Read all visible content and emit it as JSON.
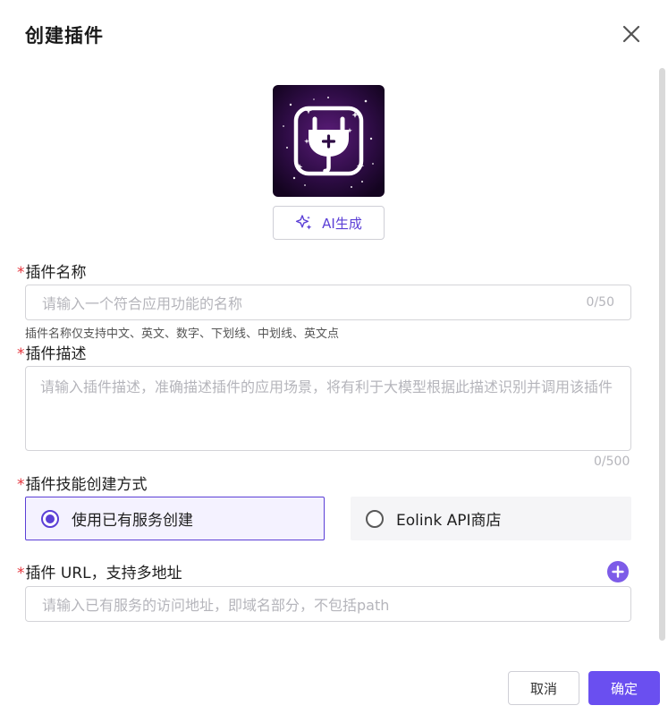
{
  "dialog": {
    "title": "创建插件",
    "ai_button_label": "AI生成",
    "name_field": {
      "required_mark": "*",
      "label": "插件名称",
      "placeholder": "请输入一个符合应用功能的名称",
      "counter": "0/50",
      "hint": "插件名称仅支持中文、英文、数字、下划线、中划线、英文点"
    },
    "description_field": {
      "required_mark": "*",
      "label": "插件描述",
      "placeholder": "请输入插件描述，准确描述插件的应用场景，将有利于大模型根据此描述识别并调用该插件",
      "counter": "0/500"
    },
    "skill_method": {
      "required_mark": "*",
      "label": "插件技能创建方式",
      "options": [
        {
          "label": "使用已有服务创建",
          "selected": true
        },
        {
          "label": "Eolink API商店",
          "selected": false
        }
      ]
    },
    "url_field": {
      "required_mark": "*",
      "label": "插件 URL，支持多地址",
      "placeholder": "请输入已有服务的访问地址，即域名部分，不包括path"
    },
    "footer": {
      "cancel_label": "取消",
      "confirm_label": "确定"
    }
  },
  "colors": {
    "accent": "#6a4ff0",
    "required": "#e5333b",
    "logo_background": "#2a0a3c"
  },
  "icons": {
    "close": "close-icon",
    "logo": "plug-icon",
    "sparkle": "sparkle-icon",
    "add": "plus-circle-icon"
  }
}
